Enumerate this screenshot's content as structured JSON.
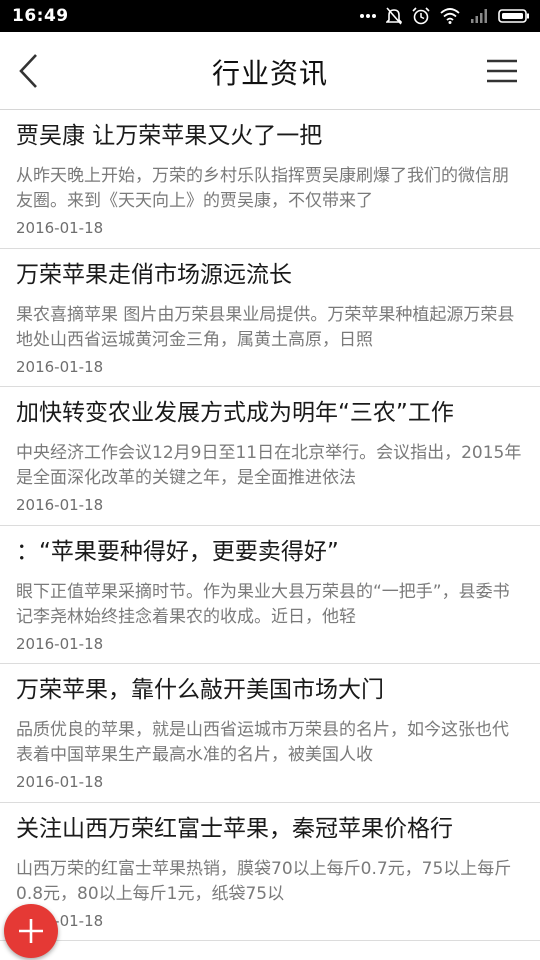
{
  "status_bar": {
    "time": "16:49",
    "icons": [
      "more-dots-icon",
      "mute-icon",
      "alarm-icon",
      "wifi-icon",
      "signal-icon",
      "battery-icon"
    ]
  },
  "header": {
    "title": "行业资讯",
    "back_icon": "chevron-left-icon",
    "menu_icon": "hamburger-menu-icon"
  },
  "news": [
    {
      "title": "贾吴康 让万荣苹果又火了一把",
      "summary": "从昨天晚上开始，万荣的乡村乐队指挥贾吴康刷爆了我们的微信朋友圈。来到《天天向上》的贾吴康，不仅带来了",
      "date": "2016-01-18"
    },
    {
      "title": "万荣苹果走俏市场源远流长",
      "summary": "果农喜摘苹果 图片由万荣县果业局提供。万荣苹果种植起源万荣县地处山西省运城黄河金三角，属黄土高原，日照",
      "date": "2016-01-18"
    },
    {
      "title": "加快转变农业发展方式成为明年“三农”工作",
      "summary": "中央经济工作会议12月9日至11日在北京举行。会议指出，2015年是全面深化改革的关键之年，是全面推进依法",
      "date": "2016-01-18"
    },
    {
      "title": "：“苹果要种得好，更要卖得好”",
      "summary": "眼下正值苹果采摘时节。作为果业大县万荣县的“一把手”，县委书记李尧林始终挂念着果农的收成。近日，他轻",
      "date": "2016-01-18"
    },
    {
      "title": "万荣苹果，靠什么敲开美国市场大门",
      "summary": "品质优良的苹果，就是山西省运城市万荣县的名片，如今这张也代表着中国苹果生产最高水准的名片，被美国人收",
      "date": "2016-01-18"
    },
    {
      "title": "关注山西万荣红富士苹果，秦冠苹果价格行",
      "summary": "山西万荣的红富士苹果热销，膜袋70以上每斤0.7元，75以上每斤0.8元，80以上每斤1元，纸袋75以",
      "date": "2016-01-18"
    }
  ],
  "fab": {
    "icon": "plus-icon"
  },
  "colors": {
    "accent": "#e53935",
    "title_text": "#1a1a1a",
    "summary_text": "#7a7a7a"
  }
}
